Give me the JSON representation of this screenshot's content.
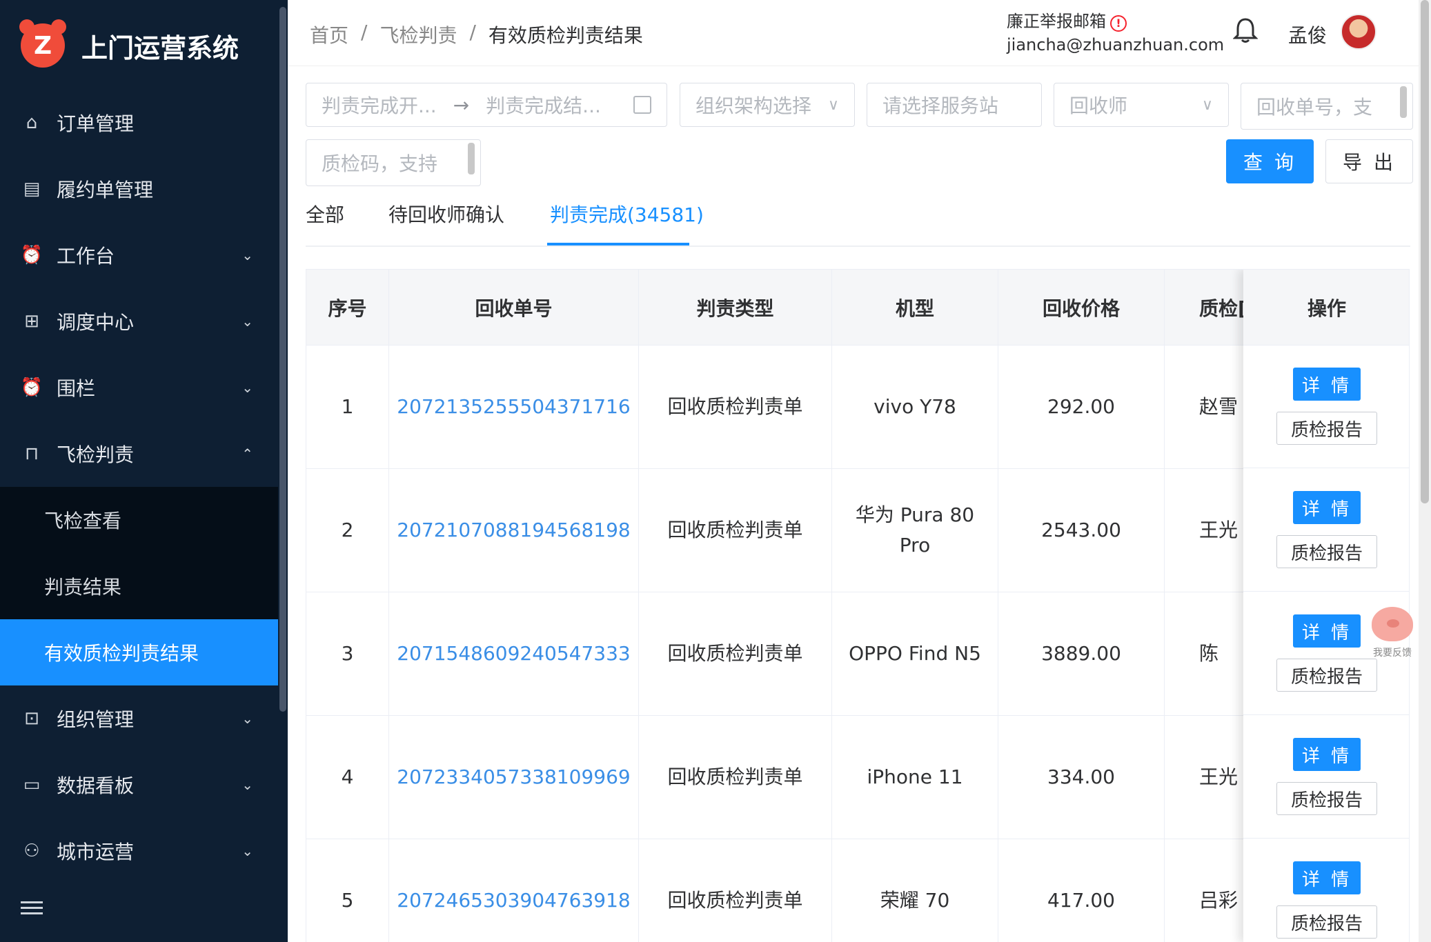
{
  "brand": {
    "logo_letter": "Z",
    "title": "上门运营系统"
  },
  "menu": [
    {
      "label": "订单管理",
      "icon": "home-icon",
      "glyph": "⌂",
      "arrow": ""
    },
    {
      "label": "履约单管理",
      "icon": "form-icon",
      "glyph": "▤",
      "arrow": ""
    },
    {
      "label": "工作台",
      "icon": "alarm-icon",
      "glyph": "⏰",
      "arrow": "⌄"
    },
    {
      "label": "调度中心",
      "icon": "grid-icon",
      "glyph": "⊞",
      "arrow": "⌄"
    },
    {
      "label": "围栏",
      "icon": "alarm-icon",
      "glyph": "⏰",
      "arrow": "⌄"
    },
    {
      "label": "飞检判责",
      "icon": "bag-icon",
      "glyph": "⊓",
      "arrow": "⌃"
    }
  ],
  "submenu": [
    {
      "label": "飞检查看"
    },
    {
      "label": "判责结果"
    },
    {
      "label": "有效质检判责结果"
    }
  ],
  "menu_bottom": [
    {
      "label": "组织管理",
      "icon": "lock-icon",
      "glyph": "⊡",
      "arrow": "⌄"
    },
    {
      "label": "数据看板",
      "icon": "monitor-icon",
      "glyph": "▭",
      "arrow": "⌄"
    },
    {
      "label": "城市运营",
      "icon": "network-icon",
      "glyph": "⚇",
      "arrow": "⌄"
    }
  ],
  "breadcrumb": {
    "home": "首页",
    "sep": "/",
    "parent": "飞检判责",
    "current": "有效质检判责结果"
  },
  "header": {
    "report_label": "廉正举报邮箱",
    "report_email": "jiancha@zhuanzhuan.com",
    "user": "孟俊"
  },
  "filters": {
    "date_start": "判责完成开...",
    "date_sep": "→",
    "date_end": "判责完成结...",
    "org": "组织架构选择",
    "station": "请选择服务站",
    "recycler": "回收师",
    "order_no": "回收单号，支",
    "qc_code": "质检码，支持",
    "query_label": "查 询",
    "export_label": "导 出",
    "chevron": "∨"
  },
  "tabs": [
    {
      "label": "全部"
    },
    {
      "label": "待回收师确认"
    },
    {
      "label": "判责完成(34581)"
    }
  ],
  "table": {
    "headers": [
      "序号",
      "回收单号",
      "判责类型",
      "机型",
      "回收价格",
      "质检[",
      "操作"
    ],
    "rows": [
      {
        "idx": "1",
        "order": "2072135255504371716",
        "type": "回收质检判责单",
        "model": "vivo Y78",
        "price": "292.00",
        "qc": "赵雪"
      },
      {
        "idx": "2",
        "order": "2072107088194568198",
        "type": "回收质检判责单",
        "model": "华为 Pura 80 Pro",
        "price": "2543.00",
        "qc": "王光"
      },
      {
        "idx": "3",
        "order": "2071548609240547333",
        "type": "回收质检判责单",
        "model": "OPPO Find N5",
        "price": "3889.00",
        "qc": "陈"
      },
      {
        "idx": "4",
        "order": "2072334057338109969",
        "type": "回收质检判责单",
        "model": "iPhone 11",
        "price": "334.00",
        "qc": "王光"
      },
      {
        "idx": "5",
        "order": "2072465303904763918",
        "type": "回收质检判责单",
        "model": "荣耀 70",
        "price": "417.00",
        "qc": "吕彩"
      }
    ],
    "detail_label": "详 情",
    "report_label": "质检报告"
  },
  "feedback": {
    "label": "我要反馈"
  },
  "colors": {
    "sidebar": "#0e1f33",
    "primary": "#1890ff",
    "link": "#3a8ee6"
  }
}
